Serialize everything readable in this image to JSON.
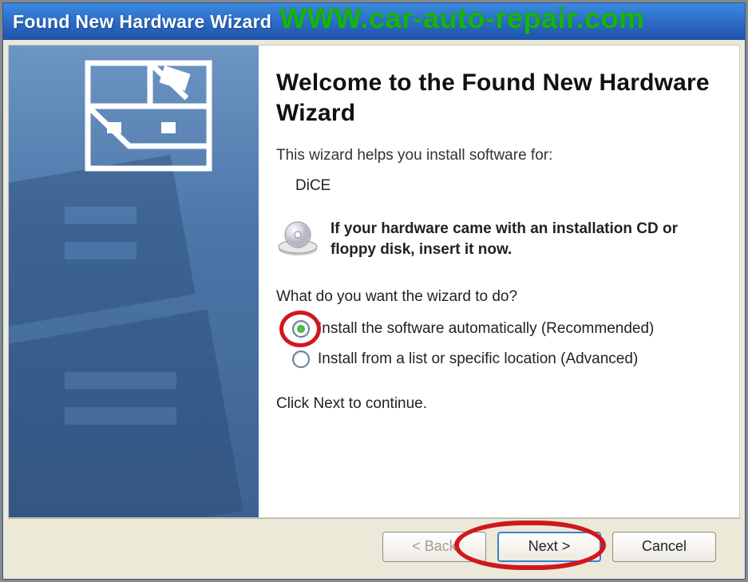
{
  "window": {
    "title": "Found New Hardware Wizard"
  },
  "watermark": "WWW.car-auto-repair.com",
  "main": {
    "heading": "Welcome to the Found New Hardware Wizard",
    "intro": "This wizard helps you install software for:",
    "device": "DiCE",
    "cd_hint": "If your hardware came with an installation CD or floppy disk, insert it now.",
    "question": "What do you want the wizard to do?",
    "options": [
      {
        "label": "Install the software automatically (Recommended)",
        "checked": true
      },
      {
        "label": "Install from a list or specific location (Advanced)",
        "checked": false
      }
    ],
    "continue_hint": "Click Next to continue."
  },
  "buttons": {
    "back": "< Back",
    "next": "Next >",
    "cancel": "Cancel"
  },
  "icons": {
    "wizard_logo": "device-box-icon",
    "cd": "cd-icon"
  },
  "annotations": {
    "highlight_option_index": 0,
    "highlight_button": "next"
  }
}
